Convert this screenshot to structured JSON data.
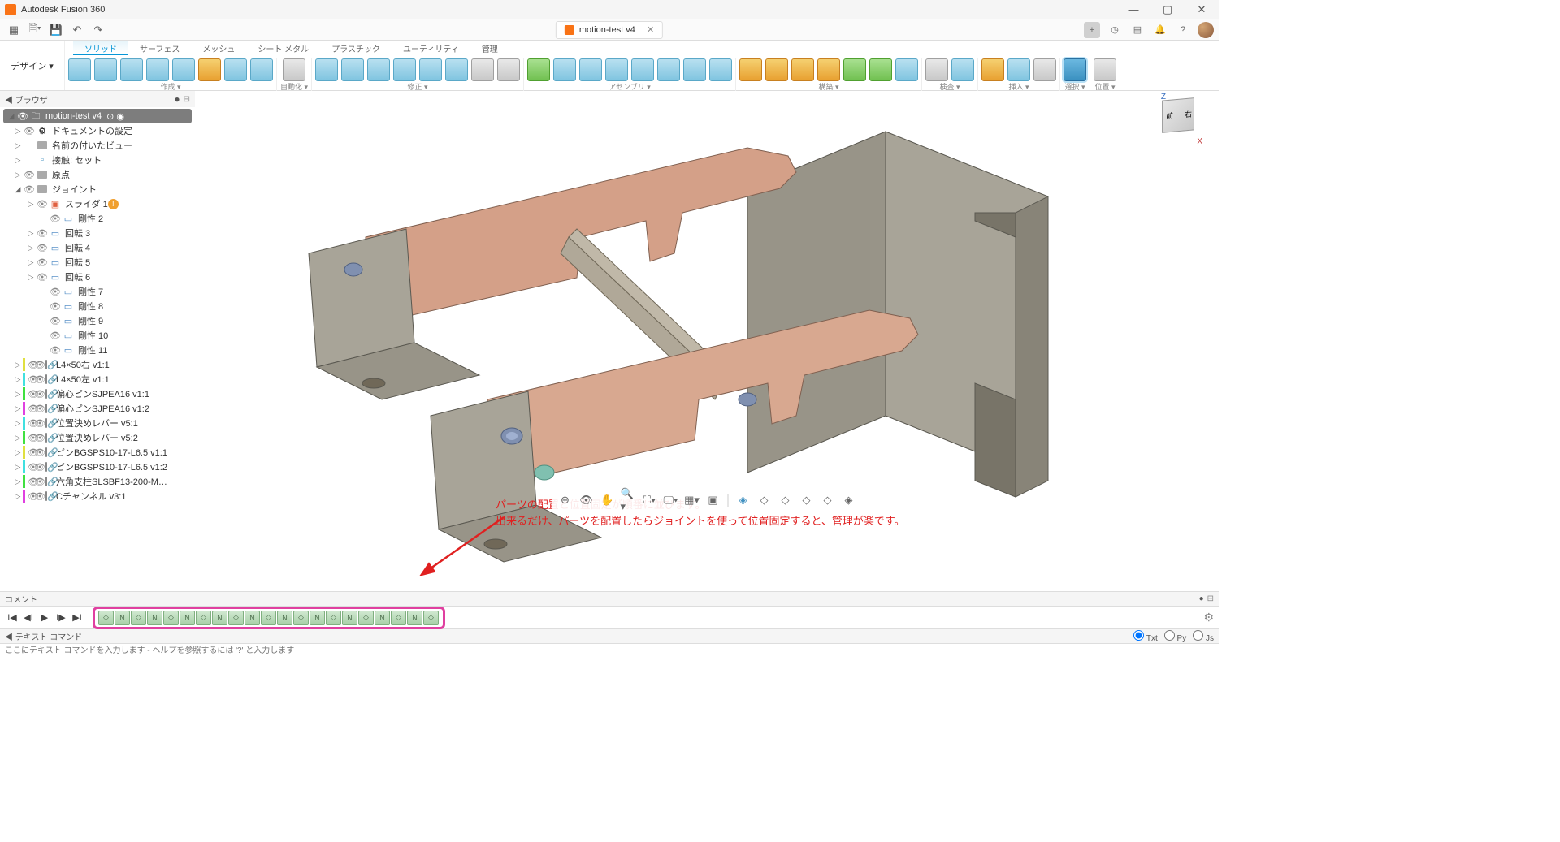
{
  "app_title": "Autodesk Fusion 360",
  "document_tab": "motion-test v4",
  "design_button": "デザイン ▾",
  "ribbon_tabs": [
    "ソリッド",
    "サーフェス",
    "メッシュ",
    "シート メタル",
    "プラスチック",
    "ユーティリティ",
    "管理"
  ],
  "ribbon_groups": {
    "create": "作成 ▾",
    "automate": "自動化 ▾",
    "modify": "修正 ▾",
    "assembly": "アセンブリ ▾",
    "construct": "構築 ▾",
    "inspect": "検査 ▾",
    "insert": "挿入 ▾",
    "select": "選択 ▾",
    "position": "位置 ▾"
  },
  "browser": {
    "title": "◀ ブラウザ",
    "root": "motion-test v4",
    "items": [
      {
        "level": 1,
        "expand": "▷",
        "eye": true,
        "type": "gear",
        "label": "ドキュメントの設定"
      },
      {
        "level": 1,
        "expand": "▷",
        "eye": false,
        "type": "folder",
        "label": "名前の付いたビュー"
      },
      {
        "level": 1,
        "expand": "▷",
        "eye": false,
        "type": "square",
        "label": "接触: セット"
      },
      {
        "level": 1,
        "expand": "▷",
        "eye": true,
        "type": "folder",
        "label": "原点"
      },
      {
        "level": 1,
        "expand": "◢",
        "eye": true,
        "type": "folder",
        "label": "ジョイント"
      },
      {
        "level": 2,
        "expand": "▷",
        "eye": true,
        "type": "joint-red",
        "label": "スライダ 1",
        "warn": true
      },
      {
        "level": 3,
        "expand": "",
        "eye": true,
        "type": "joint-blue",
        "label": "剛性 2"
      },
      {
        "level": 2,
        "expand": "▷",
        "eye": true,
        "type": "joint-blue",
        "label": "回転 3"
      },
      {
        "level": 2,
        "expand": "▷",
        "eye": true,
        "type": "joint-blue",
        "label": "回転 4"
      },
      {
        "level": 2,
        "expand": "▷",
        "eye": true,
        "type": "joint-blue",
        "label": "回転 5"
      },
      {
        "level": 2,
        "expand": "▷",
        "eye": true,
        "type": "joint-blue",
        "label": "回転 6"
      },
      {
        "level": 3,
        "expand": "",
        "eye": true,
        "type": "joint-blue",
        "label": "剛性 7"
      },
      {
        "level": 3,
        "expand": "",
        "eye": true,
        "type": "joint-blue",
        "label": "剛性 8"
      },
      {
        "level": 3,
        "expand": "",
        "eye": true,
        "type": "joint-blue",
        "label": "剛性 9"
      },
      {
        "level": 3,
        "expand": "",
        "eye": true,
        "type": "joint-blue",
        "label": "剛性 10"
      },
      {
        "level": 3,
        "expand": "",
        "eye": true,
        "type": "joint-blue",
        "label": "剛性 11"
      },
      {
        "level": 1,
        "expand": "▷",
        "eye": true,
        "type": "link",
        "colorbar": "#e0e040",
        "label": "L4×50右 v1:1"
      },
      {
        "level": 1,
        "expand": "▷",
        "eye": true,
        "type": "link",
        "colorbar": "#40e0e0",
        "label": "L4×50左 v1:1"
      },
      {
        "level": 1,
        "expand": "▷",
        "eye": true,
        "type": "link",
        "colorbar": "#40e040",
        "label": "偏心ピンSJPEA16 v1:1"
      },
      {
        "level": 1,
        "expand": "▷",
        "eye": true,
        "type": "link",
        "colorbar": "#e040e0",
        "label": "偏心ピンSJPEA16 v1:2"
      },
      {
        "level": 1,
        "expand": "▷",
        "eye": true,
        "type": "link",
        "colorbar": "#40e0e0",
        "label": "位置決めレバー v5:1"
      },
      {
        "level": 1,
        "expand": "▷",
        "eye": true,
        "type": "link",
        "colorbar": "#40e040",
        "label": "位置決めレバー v5:2"
      },
      {
        "level": 1,
        "expand": "▷",
        "eye": true,
        "type": "link",
        "colorbar": "#e0e040",
        "label": "ピンBGSPS10-17-L6.5 v1:1"
      },
      {
        "level": 1,
        "expand": "▷",
        "eye": true,
        "type": "link",
        "colorbar": "#40e0e0",
        "label": "ピンBGSPS10-17-L6.5 v1:2"
      },
      {
        "level": 1,
        "expand": "▷",
        "eye": true,
        "type": "link",
        "colorbar": "#40e040",
        "label": "六角支柱SLSBF13-200-M…"
      },
      {
        "level": 1,
        "expand": "▷",
        "eye": true,
        "type": "link",
        "colorbar": "#e040e0",
        "label": "Cチャンネル v3:1"
      }
    ]
  },
  "annotation": {
    "line1": "パーツの配置と位置固定が順番に並びます。",
    "line2": "出来るだけ、パーツを配置したらジョイントを使って位置固定すると、管理が楽です。"
  },
  "comment_title": "コメント",
  "textcmd_title": "◀ テキスト コマンド",
  "textcmd_placeholder": "ここにテキスト コマンドを入力します - ヘルプを参照するには '?' と入力します",
  "textcmd_modes": {
    "txt": "Txt",
    "py": "Py",
    "js": "Js"
  },
  "viewcube": {
    "face1": "前",
    "face2": "右"
  }
}
